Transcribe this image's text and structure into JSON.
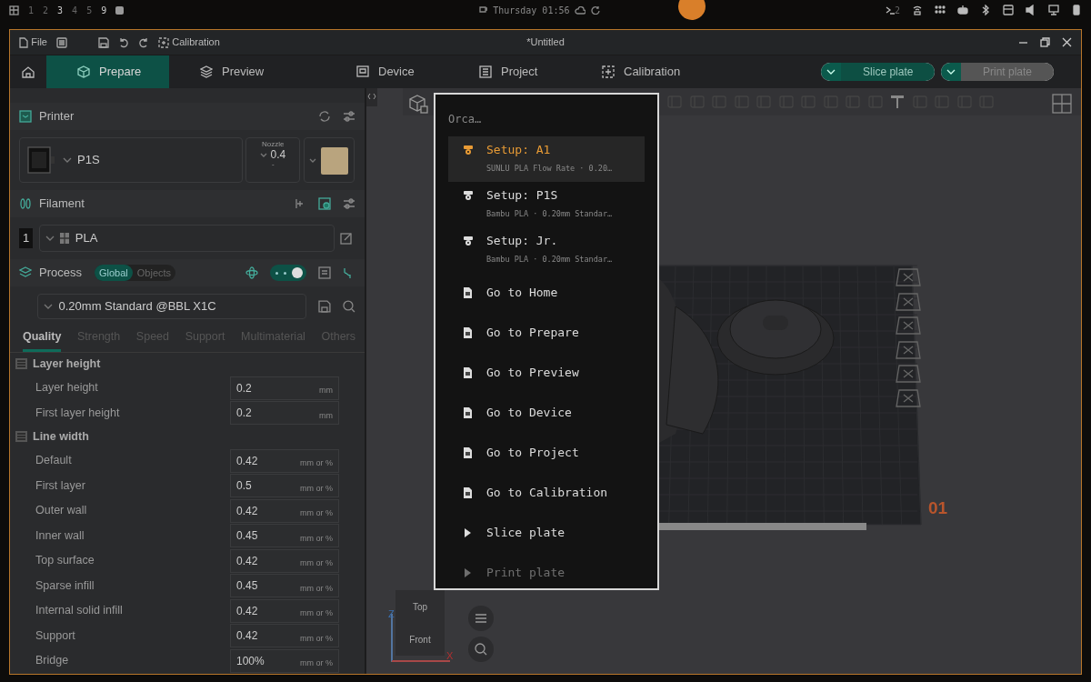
{
  "desktop_bar": {
    "workspaces": [
      {
        "label": "1",
        "highlighted": false
      },
      {
        "label": "2",
        "highlighted": false
      },
      {
        "label": "3",
        "highlighted": true
      },
      {
        "label": "4",
        "highlighted": false
      },
      {
        "label": "5",
        "highlighted": false
      },
      {
        "label": "9",
        "highlighted": true
      }
    ],
    "clock": "Thursday 01:56",
    "terminal_count": "2"
  },
  "window": {
    "title": "*Untitled",
    "menu": "File",
    "calibration": "Calibration"
  },
  "tabs": [
    {
      "label": "Prepare",
      "selected": true
    },
    {
      "label": "Preview",
      "selected": false
    },
    {
      "label": "Device",
      "selected": false
    },
    {
      "label": "Project",
      "selected": false
    },
    {
      "label": "Calibration",
      "selected": false
    }
  ],
  "actions": [
    {
      "label": "Slice plate",
      "disabled": false
    },
    {
      "label": "Print plate",
      "disabled": true
    }
  ],
  "printer": {
    "title": "Printer",
    "name": "P1S",
    "nozzle_label": "Nozzle",
    "nozzle": "0.4",
    "nozzle_note": "-"
  },
  "filament": {
    "title": "Filament",
    "items": [
      {
        "index": "1",
        "name": "PLA"
      }
    ]
  },
  "process": {
    "title": "Process",
    "scopes": [
      {
        "label": "Global",
        "selected": true
      },
      {
        "label": "Objects",
        "selected": false
      }
    ],
    "advanced_on": true,
    "preset": "0.20mm Standard @BBL X1C"
  },
  "setting_tabs": [
    {
      "label": "Quality",
      "selected": true
    },
    {
      "label": "Strength",
      "selected": false
    },
    {
      "label": "Speed",
      "selected": false
    },
    {
      "label": "Support",
      "selected": false
    },
    {
      "label": "Multimaterial",
      "selected": false
    },
    {
      "label": "Others",
      "selected": false
    }
  ],
  "groups": [
    {
      "title": "Layer height",
      "rows": [
        {
          "label": "Layer height",
          "value": "0.2",
          "unit": "mm"
        },
        {
          "label": "First layer height",
          "value": "0.2",
          "unit": "mm"
        }
      ]
    },
    {
      "title": "Line width",
      "rows": [
        {
          "label": "Default",
          "value": "0.42",
          "unit": "mm or %"
        },
        {
          "label": "First layer",
          "value": "0.5",
          "unit": "mm or %"
        },
        {
          "label": "Outer wall",
          "value": "0.42",
          "unit": "mm or %"
        },
        {
          "label": "Inner wall",
          "value": "0.45",
          "unit": "mm or %"
        },
        {
          "label": "Top surface",
          "value": "0.42",
          "unit": "mm or %"
        },
        {
          "label": "Sparse infill",
          "value": "0.45",
          "unit": "mm or %"
        },
        {
          "label": "Internal solid infill",
          "value": "0.42",
          "unit": "mm or %"
        },
        {
          "label": "Support",
          "value": "0.42",
          "unit": "mm or %"
        },
        {
          "label": "Bridge",
          "value": "100%",
          "unit": "mm or %"
        }
      ]
    }
  ],
  "palette": {
    "title": "Orca…",
    "items": [
      {
        "kind": "setup",
        "title": "Setup: A1",
        "subtitle": "SUNLU PLA Flow Rate · 0.20…",
        "selected": true
      },
      {
        "kind": "setup",
        "title": "Setup: P1S",
        "subtitle": "Bambu PLA · 0.20mm Standar…",
        "selected": false
      },
      {
        "kind": "setup",
        "title": "Setup: Jr.",
        "subtitle": "Bambu PLA · 0.20mm Standar…",
        "selected": false
      },
      {
        "kind": "page",
        "title": "Go to Home",
        "selected": false
      },
      {
        "kind": "page",
        "title": "Go to Prepare",
        "selected": false
      },
      {
        "kind": "page",
        "title": "Go to Preview",
        "selected": false
      },
      {
        "kind": "page",
        "title": "Go to Device",
        "selected": false
      },
      {
        "kind": "page",
        "title": "Go to Project",
        "selected": false
      },
      {
        "kind": "page",
        "title": "Go to Calibration",
        "selected": false
      },
      {
        "kind": "action",
        "title": "Slice plate",
        "selected": false
      },
      {
        "kind": "action",
        "title": "Print plate",
        "selected": false,
        "faded": true
      }
    ]
  },
  "viewport": {
    "plate_number": "01",
    "view_cube": [
      "Top",
      "Front"
    ],
    "axes": [
      "Z",
      "X"
    ]
  }
}
